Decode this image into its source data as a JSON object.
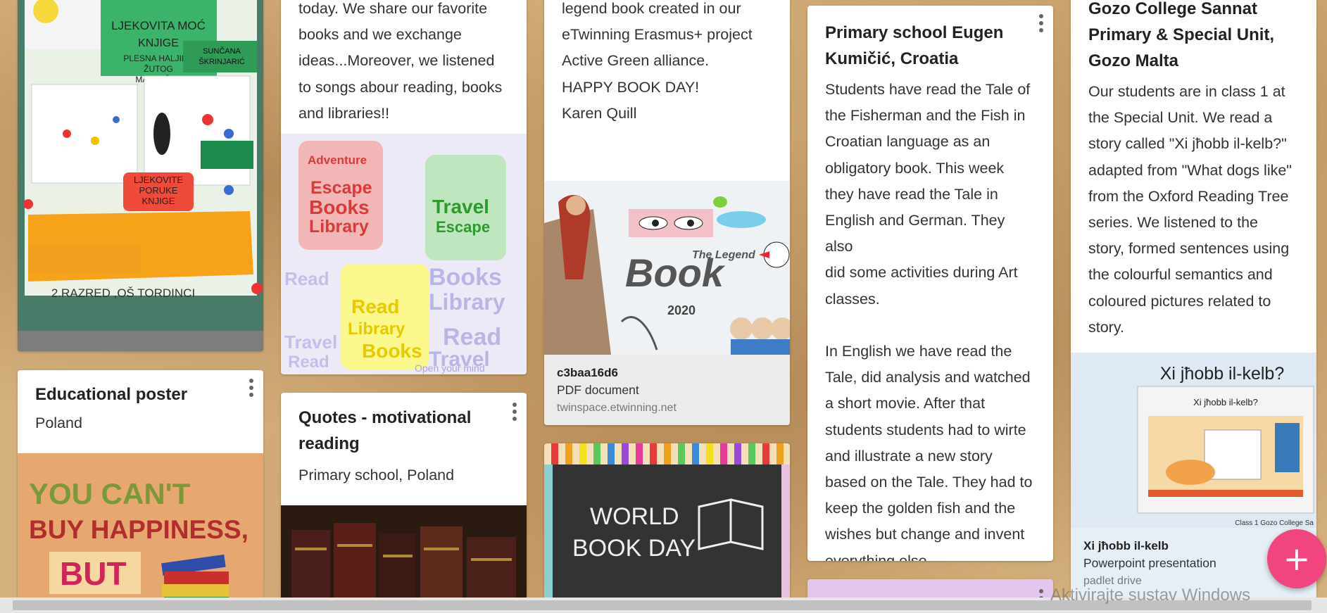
{
  "colors": {
    "fab": "#f0457e",
    "card": "#ffffff",
    "attachment": "#ebebeb",
    "board": "#d4b07c"
  },
  "col1": {
    "image1": {
      "lines": [
        "LJEKOVITA MOĆ",
        "KNJIGE",
        "PLESNA HALJINA",
        "ŽUTOG",
        "MASLAČKA",
        "SUNČANA",
        "ŠKRINJARIĆ",
        "LJEKOVITE",
        "PORUKE",
        "KNJIGE",
        "2.RAZRED ,OŠ TORDINCI"
      ]
    },
    "post": {
      "title": "Educational poster",
      "body": "Poland"
    },
    "poster_image": {
      "line1": "YOU CAN'T",
      "line2": "BUY HAPPINESS,",
      "line3": "BUT"
    }
  },
  "col2": {
    "top_text": [
      "today. We share our favorite",
      "books and we  exchange",
      "ideas...Moreover, we listened",
      "to songs abour reading, books",
      "and libraries!!"
    ],
    "wordcloud": {
      "words": [
        "Adventure",
        "Escape",
        "Books",
        "Library",
        "Travel",
        "Read",
        "Open your mind"
      ]
    },
    "post": {
      "title_line1": "Quotes - motivational",
      "title_line2": "reading",
      "body": "Primary school, Poland"
    }
  },
  "col3": {
    "top_text": [
      "legend book created in our",
      "eTwinning Erasmus+ project",
      "Active Green alliance.",
      "HAPPY BOOK DAY!",
      "Karen Quill"
    ],
    "book_image": {
      "small_title": "The Legend",
      "big_title": "Book",
      "year": "2020"
    },
    "attachment": {
      "title": "c3baa16d6",
      "type": "PDF document",
      "source": "twinspace.etwinning.net"
    },
    "chalkboard": {
      "line1": "WORLD",
      "line2": "BOOK DAY"
    }
  },
  "col4": {
    "post": {
      "title_line1": "Primary school Eugen",
      "title_line2": "Kumičić, Croatia",
      "body_lines": [
        "Students have read the Tale of",
        "the Fisherman and the Fish in",
        "Croatian language as an",
        "obligatory book. This week",
        "they have read the Tale in",
        "English and German. They also",
        "did some activities during Art",
        "classes.",
        "",
        "In English we have read the",
        "Tale, did analysis and watched",
        "a short movie. After that",
        "students students had to wirte",
        "and illustrate a new story",
        "based on the Tale. They had to",
        "keep the golden fish and the",
        "wishes but change and invent",
        "everything else."
      ]
    }
  },
  "col5": {
    "post": {
      "title_line1": "Gozo College Sannat",
      "title_line2": "Primary & Special Unit,",
      "title_line3": "Gozo Malta",
      "body_lines": [
        "Our students are in class 1 at",
        "the Special Unit.  We read a",
        "story called \"Xi jħobb il-kelb?\"",
        "adapted from \"What dogs like\"",
        "from the Oxford Reading Tree",
        "series.  We listened to the",
        "story,  formed sentences using",
        "the colourful semantics and",
        "coloured pictures related to",
        "story."
      ]
    },
    "slide": {
      "heading": "Xi jħobb il-kelb?",
      "inner_title": "Xi jħobb il-kelb?",
      "footer": "Class 1 Gozo College Sa"
    },
    "attachment": {
      "title": "Xi jħobb il-kelb",
      "type": "Powerpoint presentation",
      "source": "padlet drive"
    }
  },
  "fab": {
    "label": "+"
  },
  "watermark": {
    "text": "Aktivirajte sustav Windows"
  }
}
